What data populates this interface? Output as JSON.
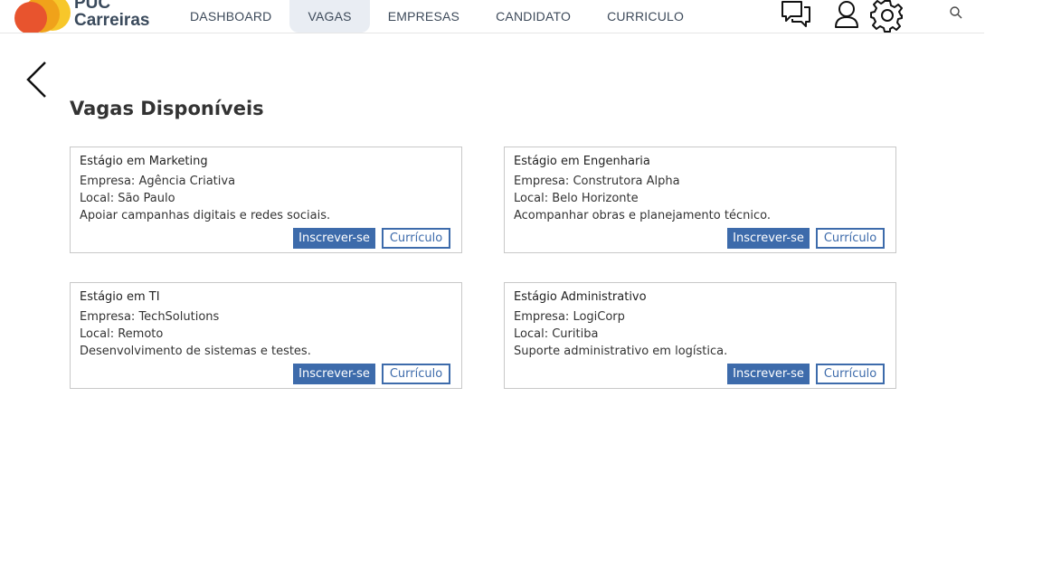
{
  "brand": {
    "line1": "PUC",
    "line2": "Carreiras",
    "colors": [
      "#e8542e",
      "#f0a21a",
      "#f7c72a"
    ]
  },
  "nav": {
    "items": [
      "DASHBOARD",
      "VAGAS",
      "EMPRESAS",
      "CANDIDATO",
      "CURRICULO"
    ],
    "active": "VAGAS"
  },
  "header_icons": [
    "chat-icon",
    "user-icon",
    "settings-icon",
    "search-icon"
  ],
  "page": {
    "title": "Vagas Disponíveis"
  },
  "jobs": [
    {
      "title": "Estágio em Marketing",
      "company": "Empresa: Agência Criativa",
      "location": "Local: São Paulo",
      "description": "Apoiar campanhas digitais e redes sociais.",
      "apply_label": "Inscrever-se",
      "resume_label": "Currículo"
    },
    {
      "title": "Estágio em Engenharia",
      "company": "Empresa: Construtora Alpha",
      "location": "Local: Belo Horizonte",
      "description": "Acompanhar obras e planejamento técnico.",
      "apply_label": "Inscrever-se",
      "resume_label": "Currículo"
    },
    {
      "title": "Estágio em TI",
      "company": "Empresa: TechSolutions",
      "location": "Local: Remoto",
      "description": "Desenvolvimento de sistemas e testes.",
      "apply_label": "Inscrever-se",
      "resume_label": "Currículo"
    },
    {
      "title": "Estágio Administrativo",
      "company": "Empresa: LogiCorp",
      "location": "Local: Curitiba",
      "description": "Suporte administrativo em logística.",
      "apply_label": "Inscrever-se",
      "resume_label": "Currículo"
    }
  ],
  "colors": {
    "primary": "#3d6bab",
    "nav_active_bg": "#e9edf3"
  }
}
